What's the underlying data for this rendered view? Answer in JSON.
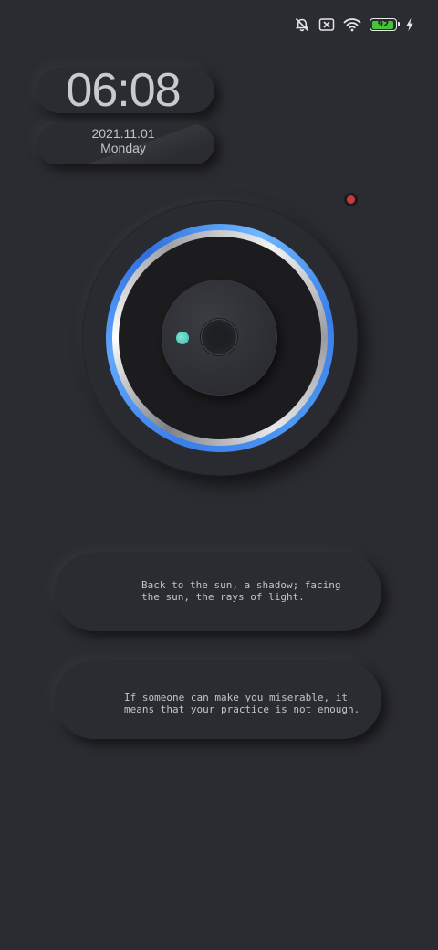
{
  "status_bar": {
    "icons": [
      "alarm-off-icon",
      "no-sim-icon",
      "wifi-icon",
      "battery-icon",
      "charging-bolt-icon"
    ],
    "battery_level": 92,
    "battery_text": "92",
    "battery_color": "#47c23a"
  },
  "clock": {
    "time": "06:08",
    "date": "2021.11.01",
    "weekday": "Monday"
  },
  "camera": {
    "indicator_color": "#c8393c",
    "ring_color": "#3a7ee8",
    "sensor_color": "#3bb6a7"
  },
  "quotes": [
    {
      "text": "Back to the sun, a shadow; facing\nthe sun, the rays of light."
    },
    {
      "text": "If someone can make you miserable, it\nmeans that your practice is not enough."
    }
  ]
}
